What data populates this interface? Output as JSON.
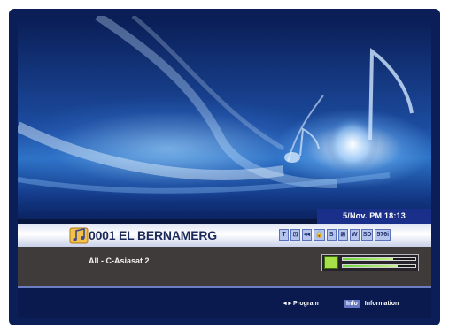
{
  "status": {
    "datetime": "5/Nov. PM 18:13"
  },
  "channel": {
    "number_name": "0001 EL BERNAMERG",
    "flags": [
      "T",
      "⊡",
      "◂◂",
      "🔒",
      "S",
      "⊠",
      "W",
      "SD",
      "576i"
    ]
  },
  "detail": {
    "satellite": "All - C-Asiasat 2",
    "signal": {
      "quality": 0.7,
      "level": 0.75
    }
  },
  "help": {
    "arrows": "◂ ▸",
    "program_label": "Program",
    "info_key": "Info",
    "info_label": "Information"
  },
  "colors": {
    "bar_fill": "#6fd43b",
    "help_key": "#6777c2",
    "info_bar_text": "#1c2a5a"
  }
}
